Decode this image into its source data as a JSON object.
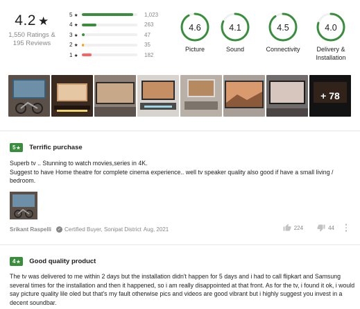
{
  "summary": {
    "average": "4.2",
    "star": "★",
    "ratings_text": "1,550 Ratings &",
    "reviews_text": "195 Reviews"
  },
  "distribution": [
    {
      "stars": "5",
      "count": "1,023",
      "fraction": 0.92,
      "color": "#388e3c"
    },
    {
      "stars": "4",
      "count": "263",
      "fraction": 0.26,
      "color": "#388e3c"
    },
    {
      "stars": "3",
      "count": "47",
      "fraction": 0.05,
      "color": "#388e3c"
    },
    {
      "stars": "2",
      "count": "35",
      "fraction": 0.04,
      "color": "#ff9f00"
    },
    {
      "stars": "1",
      "count": "182",
      "fraction": 0.18,
      "color": "#ff6161"
    }
  ],
  "aspects": [
    {
      "value": "4.6",
      "label": "Picture",
      "label2": "",
      "fraction": 0.92
    },
    {
      "value": "4.1",
      "label": "Sound",
      "label2": "",
      "fraction": 0.82
    },
    {
      "value": "4.5",
      "label": "Connectivity",
      "label2": "",
      "fraction": 0.9
    },
    {
      "value": "4.0",
      "label": "Delivery &",
      "label2": "Installation",
      "fraction": 0.8
    }
  ],
  "photos_more": "+ 78",
  "reviews": [
    {
      "rating": "5",
      "title": "Terrific purchase",
      "body_line1": "Superb tv .. Stunning to watch movies,series in 4K.",
      "body_line2": "Suggest to have Home theatre for complete cinema experience.. well tv speaker quality also good if have a small living / bedroom.",
      "author": "Srikant Raspelli",
      "buyer": "Certified Buyer, Sonipat District",
      "date": "Aug, 2021",
      "likes": "224",
      "dislikes": "44"
    },
    {
      "rating": "4",
      "title": "Good quality product",
      "body": "The tv was delivered to me within 2 days but the installation didn't happen for 5 days and i had to call flipkart and Samsung several times for the installation and then it happened, so i am really disappointed at that front. As for the tv, i found it ok, i would say picture quality lile oled but that's my fault otherwise pics and videos are good vibrant but i highly suggest you invest in a decent soundbar."
    }
  ],
  "colors": {
    "accent_green": "#388e3c",
    "orange": "#ff9f00",
    "red": "#ff6161",
    "muted": "#878787"
  }
}
